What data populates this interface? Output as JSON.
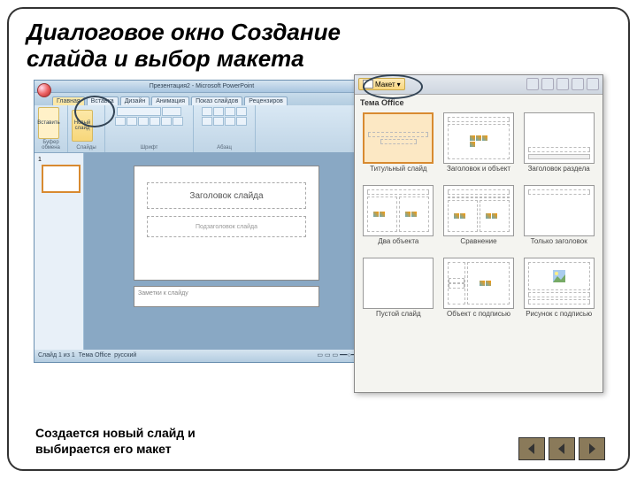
{
  "title_line1": "Диалоговое окно Создание",
  "title_line2": "слайда и выбор макета",
  "caption": "Создается новый слайд и выбирается его макет",
  "pp": {
    "titlebar": "Презентация2 - Microsoft PowerPoint",
    "tabs": [
      "Главная",
      "Вставка",
      "Дизайн",
      "Анимация",
      "Показ слайдов",
      "Рецензиров"
    ],
    "group_clipboard": "Буфер обмена",
    "group_slides": "Слайды",
    "group_font": "Шрифт",
    "group_para": "Абзац",
    "paste": "Вставить",
    "newslide_top": "Новый",
    "newslide_bot": "слайд",
    "slide_title": "Заголовок слайда",
    "slide_subtitle": "Подзаголовок слайда",
    "notes": "Заметки к слайду",
    "status_left": "Слайд 1 из 1",
    "status_theme": "Тема Office",
    "status_lang": "русский"
  },
  "popup": {
    "layout_btn": "Макет",
    "theme": "Тема Office",
    "layouts": [
      {
        "name": "Титульный слайд",
        "selected": true,
        "type": "title"
      },
      {
        "name": "Заголовок и объект",
        "type": "title_content"
      },
      {
        "name": "Заголовок раздела",
        "type": "section"
      },
      {
        "name": "Два объекта",
        "type": "two"
      },
      {
        "name": "Сравнение",
        "type": "compare"
      },
      {
        "name": "Только заголовок",
        "type": "only_title"
      },
      {
        "name": "Пустой слайд",
        "type": "blank"
      },
      {
        "name": "Объект с подписью",
        "type": "caption"
      },
      {
        "name": "Рисунок с подписью",
        "type": "pic"
      }
    ]
  }
}
